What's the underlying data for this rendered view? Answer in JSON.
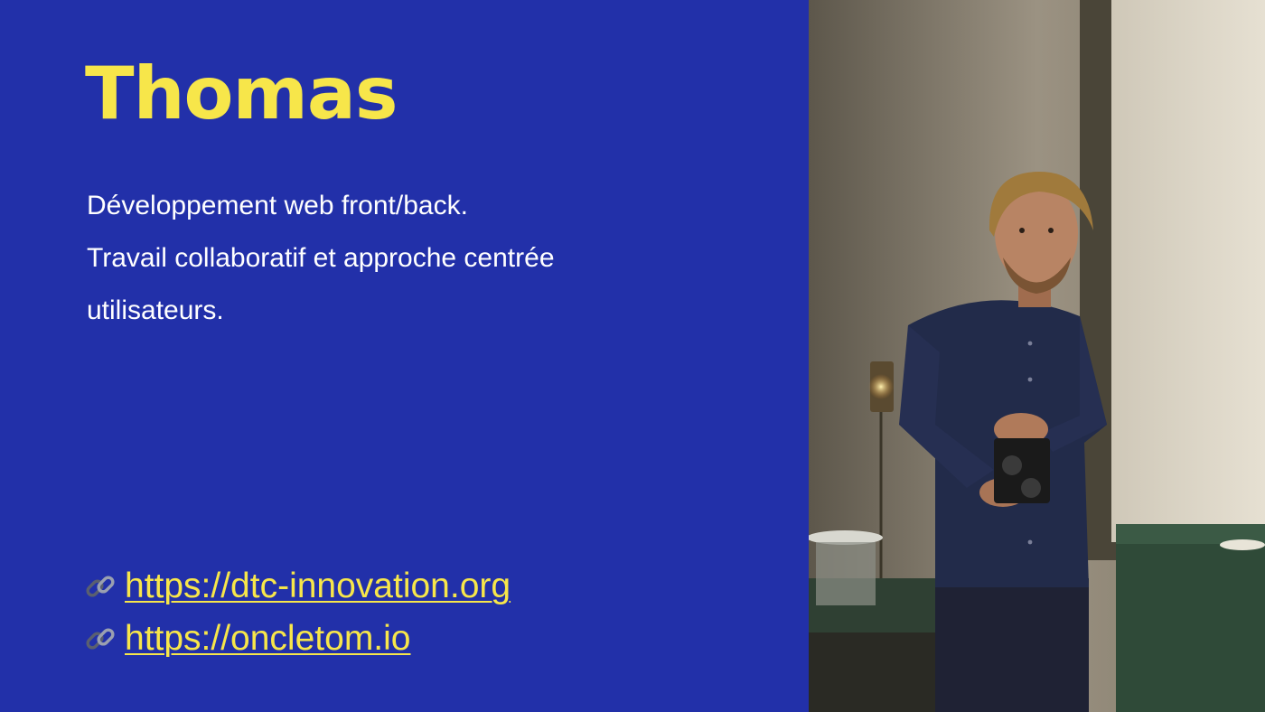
{
  "theme": {
    "background": "#2230a9",
    "accent": "#f7e64a",
    "text": "#ffffff"
  },
  "slide": {
    "title": "Thomas",
    "description": [
      "Développement web front/back.",
      "Travail collaboratif et approche centrée",
      "utilisateurs."
    ],
    "links": [
      {
        "icon": "link-icon",
        "label": "https://dtc-innovation.org"
      },
      {
        "icon": "link-icon",
        "label": "https://oncletom.io"
      }
    ],
    "photo": {
      "subject": "portrait-photo"
    }
  }
}
